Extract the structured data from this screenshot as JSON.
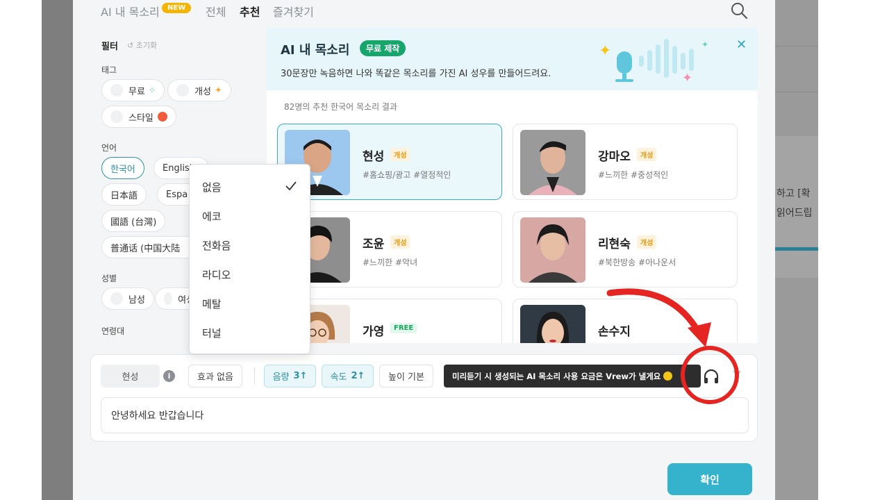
{
  "tabs": {
    "ai_voice": "AI 내 목소리",
    "new_badge": "NEW",
    "all": "전체",
    "recommended": "추천",
    "favorites": "즐겨찾기"
  },
  "filter": {
    "title": "필터",
    "reset": "초기화",
    "tag_label": "태그",
    "tags": [
      "무료",
      "개성",
      "스타일"
    ],
    "language_label": "언어",
    "languages": [
      "한국어",
      "English",
      "日本語",
      "Espa",
      "國語 (台灣)",
      "普通话 (中国大陆"
    ],
    "gender_label": "성별",
    "genders": [
      "남성",
      "여성"
    ],
    "age_label": "연령대"
  },
  "banner": {
    "title": "AI 내 목소리",
    "pill": "무료 제작",
    "desc": "30문장만 녹음하면 나와 똑같은 목소리를 가진 AI 성우를 만들어드려요.",
    "close": "✕"
  },
  "result_text": "82명의 추천 한국어 목소리 결과",
  "voices": [
    {
      "name": "현성",
      "badge": "개성",
      "tags": "#홈쇼핑/광고 #열정적인"
    },
    {
      "name": "강마오",
      "badge": "개성",
      "tags": "#느끼한 #중성적인"
    },
    {
      "name": "조윤",
      "badge": "개성",
      "tags": "#느끼한 #악녀"
    },
    {
      "name": "리현숙",
      "badge": "개성",
      "tags": "#북한방송 #아나운서"
    },
    {
      "name": "가영",
      "badge": "FREE",
      "tags": ""
    },
    {
      "name": "손수지",
      "badge": "",
      "tags": ""
    }
  ],
  "dropdown": {
    "items": [
      "없음",
      "에코",
      "전화음",
      "라디오",
      "메탈",
      "터널"
    ],
    "selected": "없음"
  },
  "editor": {
    "voice_name": "현성",
    "effect": "효과 없음",
    "volume_label": "음량",
    "volume_value": "3↑",
    "speed_label": "속도",
    "speed_value": "2↑",
    "pitch": "높이 기본",
    "tooltip": "미리듣기 시 생성되는 AI 목소리 사용 요금은 Vrew가 낼게요",
    "text": "안녕하세요 반갑습니다"
  },
  "confirm": "확인",
  "background_text": [
    "하고 [확",
    "읽어드립"
  ],
  "colors": {
    "accent": "#35b2cc",
    "annotation": "#e52521",
    "badge_new": "#f4b400"
  }
}
